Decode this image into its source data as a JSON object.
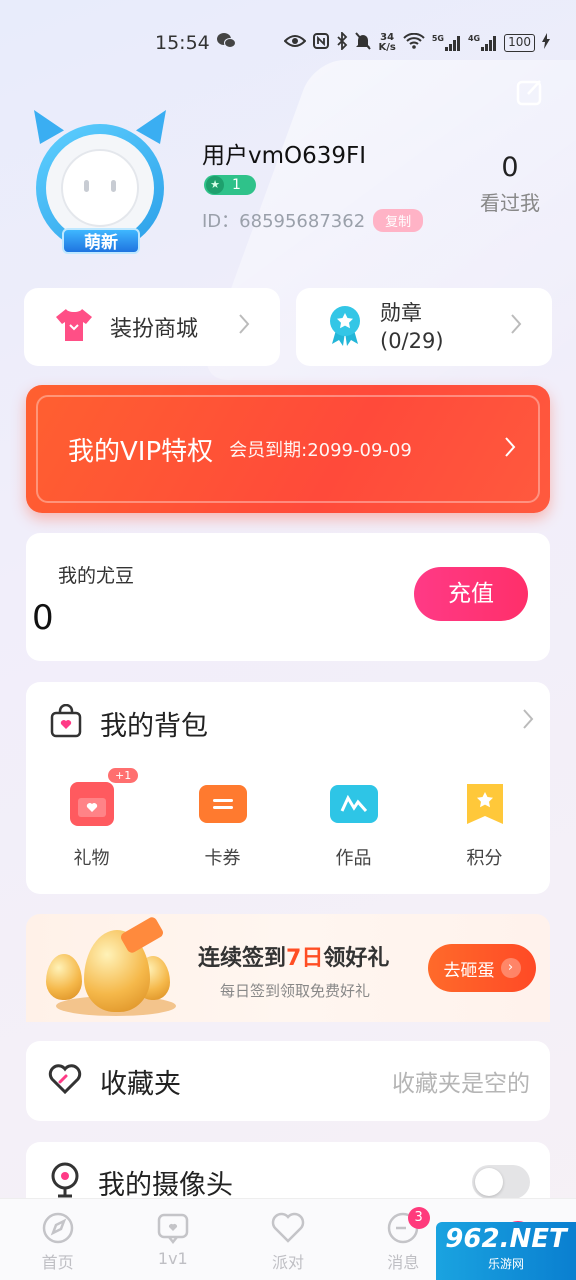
{
  "status_bar": {
    "time": "15:54",
    "net_speed_value": "34",
    "net_speed_unit": "K/s",
    "sim1": "5G",
    "sim2": "4G",
    "battery": "100"
  },
  "profile": {
    "username": "用户vmO639FI",
    "level": "1",
    "id_label": "ID：",
    "id_value": "68595687362",
    "copy_label": "复制",
    "badge": "萌新",
    "visitors_count": "0",
    "visitors_label": "看过我"
  },
  "shortcuts": {
    "shop_label": "装扮商城",
    "medal_label": "勋章",
    "medal_progress": "(0/29)"
  },
  "vip": {
    "title": "我的VIP特权",
    "expire": "会员到期:2099-09-09"
  },
  "beans": {
    "label": "我的尤豆",
    "value": "0",
    "recharge_label": "充值"
  },
  "backpack": {
    "title": "我的背包",
    "items": [
      {
        "label": "礼物",
        "icon": "gift-icon",
        "color": "#ff5a5f",
        "badge": "+1"
      },
      {
        "label": "卡券",
        "icon": "ticket-icon",
        "color": "#ff7a2f"
      },
      {
        "label": "作品",
        "icon": "works-icon",
        "color": "#2ec5e6"
      },
      {
        "label": "积分",
        "icon": "points-icon",
        "color": "#ffc83a"
      }
    ]
  },
  "signin": {
    "title_prefix": "连续签到",
    "title_highlight": "7日",
    "title_suffix": "领好礼",
    "subtitle": "每日签到领取免费好礼",
    "button_label": "去砸蛋"
  },
  "favorites": {
    "title": "收藏夹",
    "empty_text": "收藏夹是空的"
  },
  "camera": {
    "title": "我的摄像头",
    "enabled": false
  },
  "bottom_nav": {
    "items": [
      {
        "label": "首页"
      },
      {
        "label": "1v1"
      },
      {
        "label": "派对"
      },
      {
        "label": "消息",
        "badge": "3"
      }
    ]
  },
  "watermark": {
    "big": "962.NET",
    "small": "乐游网"
  },
  "colors": {
    "accent_pink": "#ff2f6a",
    "vip_orange": "#ff4a3a",
    "level_green": "#2fc28a"
  }
}
